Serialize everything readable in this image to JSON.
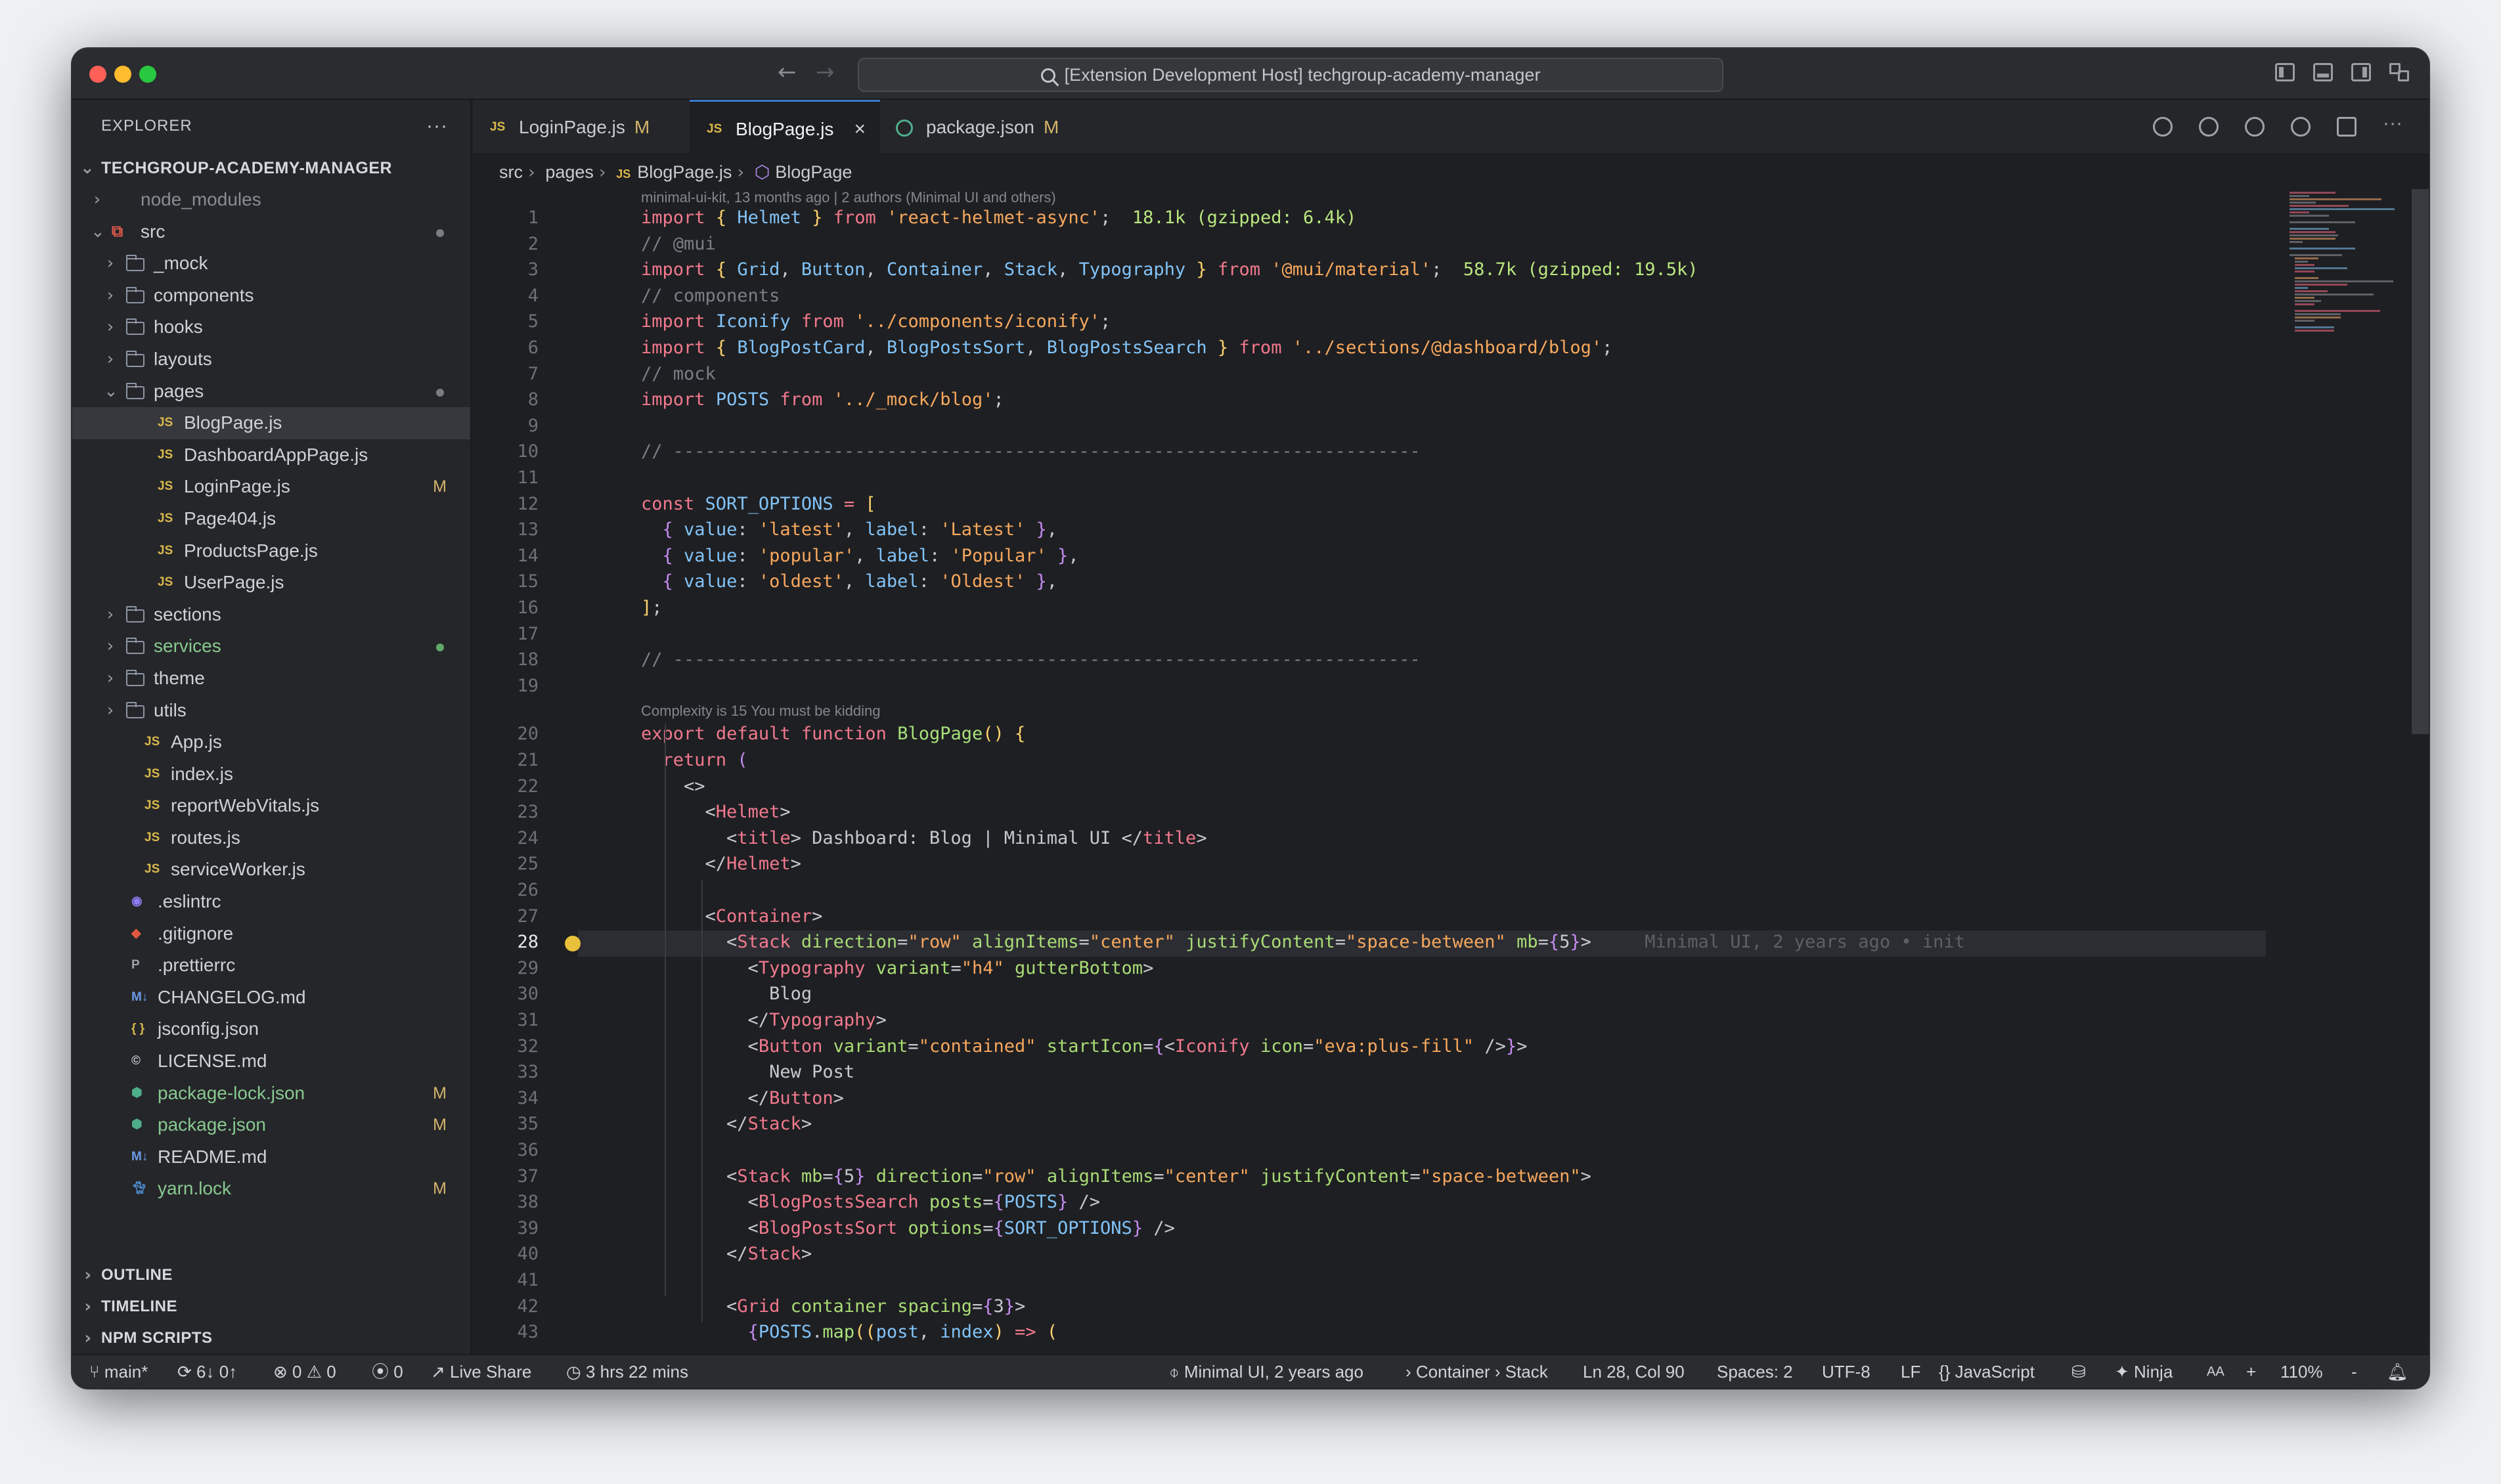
{
  "window": {
    "title": "[Extension Development Host] techgroup-academy-manager"
  },
  "sidebar": {
    "title": "EXPLORER",
    "more": "···",
    "project": "TECHGROUP-ACADEMY-MANAGER",
    "tree": [
      {
        "label": "node_modules",
        "kind": "folder",
        "depth": 0,
        "open": false,
        "dim": true
      },
      {
        "label": "src",
        "kind": "folder-src",
        "depth": 0,
        "open": true,
        "dot": "grey"
      },
      {
        "label": "_mock",
        "kind": "folder",
        "depth": 1,
        "open": false
      },
      {
        "label": "components",
        "kind": "folder",
        "depth": 1,
        "open": false
      },
      {
        "label": "hooks",
        "kind": "folder",
        "depth": 1,
        "open": false
      },
      {
        "label": "layouts",
        "kind": "folder",
        "depth": 1,
        "open": false
      },
      {
        "label": "pages",
        "kind": "folder",
        "depth": 1,
        "open": true,
        "dot": "grey"
      },
      {
        "label": "BlogPage.js",
        "kind": "js",
        "depth": 2,
        "selected": true
      },
      {
        "label": "DashboardAppPage.js",
        "kind": "js",
        "depth": 2
      },
      {
        "label": "LoginPage.js",
        "kind": "js",
        "depth": 2,
        "status": "M"
      },
      {
        "label": "Page404.js",
        "kind": "js",
        "depth": 2
      },
      {
        "label": "ProductsPage.js",
        "kind": "js",
        "depth": 2
      },
      {
        "label": "UserPage.js",
        "kind": "js",
        "depth": 2
      },
      {
        "label": "sections",
        "kind": "folder",
        "depth": 1,
        "open": false
      },
      {
        "label": "services",
        "kind": "folder",
        "depth": 1,
        "open": false,
        "green": true,
        "dot": "green"
      },
      {
        "label": "theme",
        "kind": "folder",
        "depth": 1,
        "open": false
      },
      {
        "label": "utils",
        "kind": "folder",
        "depth": 1,
        "open": false
      },
      {
        "label": "App.js",
        "kind": "js",
        "depth": 1
      },
      {
        "label": "index.js",
        "kind": "js",
        "depth": 1
      },
      {
        "label": "reportWebVitals.js",
        "kind": "js",
        "depth": 1
      },
      {
        "label": "routes.js",
        "kind": "js",
        "depth": 1
      },
      {
        "label": "serviceWorker.js",
        "kind": "js",
        "depth": 1
      },
      {
        "label": ".eslintrc",
        "kind": "eslint",
        "depth": 0
      },
      {
        "label": ".gitignore",
        "kind": "git",
        "depth": 0
      },
      {
        "label": ".prettierrc",
        "kind": "prettier",
        "depth": 0
      },
      {
        "label": "CHANGELOG.md",
        "kind": "md",
        "depth": 0
      },
      {
        "label": "jsconfig.json",
        "kind": "json",
        "depth": 0
      },
      {
        "label": "LICENSE.md",
        "kind": "license",
        "depth": 0
      },
      {
        "label": "package-lock.json",
        "kind": "npm",
        "depth": 0,
        "status": "M",
        "green": true
      },
      {
        "label": "package.json",
        "kind": "npm",
        "depth": 0,
        "status": "M",
        "green": true
      },
      {
        "label": "README.md",
        "kind": "md",
        "depth": 0
      },
      {
        "label": "yarn.lock",
        "kind": "yarn",
        "depth": 0,
        "status": "M",
        "green": true
      }
    ],
    "sections": [
      "OUTLINE",
      "TIMELINE",
      "NPM SCRIPTS"
    ]
  },
  "tabs": [
    {
      "label": "LoginPage.js",
      "badge": "M",
      "icon": "js"
    },
    {
      "label": "BlogPage.js",
      "badge": "",
      "icon": "js",
      "active": true,
      "close": "×"
    },
    {
      "label": "package.json",
      "badge": "M",
      "icon": "npm"
    }
  ],
  "breadcrumb": {
    "items": [
      "src",
      "pages",
      "BlogPage.js",
      "BlogPage"
    ],
    "js_badge": "JS"
  },
  "editor": {
    "blame_header": "minimal-ui-kit, 13 months ago | 2 authors (Minimal UI and others)",
    "complexity_hint": "Complexity is 15 You must be kidding",
    "inline_blame": "Minimal UI, 2 years ago • init",
    "current_line": 28,
    "lines": [
      {
        "n": "1",
        "html": "<span class='kw'>import</span> <span class='cl'>{</span> <span class='id'>Helmet</span> <span class='cl'>}</span> <span class='kw'>from</span> <span class='st'>'react-helmet-async'</span>;  <span class='sz'>18.1k (gzipped: 6.4k)</span>"
      },
      {
        "n": "2",
        "html": "<span class='cm'>// @mui</span>"
      },
      {
        "n": "3",
        "html": "<span class='kw'>import</span> <span class='cl'>{</span> <span class='id'>Grid</span>, <span class='id'>Button</span>, <span class='id'>Container</span>, <span class='id'>Stack</span>, <span class='id'>Typography</span> <span class='cl'>}</span> <span class='kw'>from</span> <span class='st'>'@mui/material'</span>;  <span class='sz'>58.7k (gzipped: 19.5k)</span>"
      },
      {
        "n": "4",
        "html": "<span class='cm'>// components</span>"
      },
      {
        "n": "5",
        "html": "<span class='kw'>import</span> <span class='id'>Iconify</span> <span class='kw'>from</span> <span class='st'>'../components/iconify'</span>;"
      },
      {
        "n": "6",
        "html": "<span class='kw'>import</span> <span class='cl'>{</span> <span class='id'>BlogPostCard</span>, <span class='id'>BlogPostsSort</span>, <span class='id'>BlogPostsSearch</span> <span class='cl'>}</span> <span class='kw'>from</span> <span class='st'>'../sections/@dashboard/blog'</span>;"
      },
      {
        "n": "7",
        "html": "<span class='cm'>// mock</span>"
      },
      {
        "n": "8",
        "html": "<span class='kw'>import</span> <span class='id'>POSTS</span> <span class='kw'>from</span> <span class='st'>'../_mock/blog'</span>;"
      },
      {
        "n": "9",
        "html": ""
      },
      {
        "n": "10",
        "html": "<span class='cm'>// ----------------------------------------------------------------------</span>"
      },
      {
        "n": "11",
        "html": ""
      },
      {
        "n": "12",
        "html": "<span class='kw'>const</span> <span class='id'>SORT_OPTIONS</span> <span class='kw'>=</span> <span class='cl'>[</span>"
      },
      {
        "n": "13",
        "html": "  <span class='br'>{</span> <span class='id'>value</span>: <span class='st'>'latest'</span>, <span class='id'>label</span>: <span class='st'>'Latest'</span> <span class='br'>}</span>,"
      },
      {
        "n": "14",
        "html": "  <span class='br'>{</span> <span class='id'>value</span>: <span class='st'>'popular'</span>, <span class='id'>label</span>: <span class='st'>'Popular'</span> <span class='br'>}</span>,"
      },
      {
        "n": "15",
        "html": "  <span class='br'>{</span> <span class='id'>value</span>: <span class='st'>'oldest'</span>, <span class='id'>label</span>: <span class='st'>'Oldest'</span> <span class='br'>}</span>,"
      },
      {
        "n": "16",
        "html": "<span class='cl'>]</span>;"
      },
      {
        "n": "17",
        "html": ""
      },
      {
        "n": "18",
        "html": "<span class='cm'>// ----------------------------------------------------------------------</span>"
      },
      {
        "n": "19",
        "html": ""
      },
      {
        "n": "20",
        "html": "<span class='kw'>export</span> <span class='kw'>default</span> <span class='kw'>function</span> <span class='fn'>BlogPage</span><span class='cl'>()</span> <span class='cl'>{</span>"
      },
      {
        "n": "21",
        "html": "  <span class='kw'>return</span> <span class='br'>(</span>"
      },
      {
        "n": "22",
        "html": "    &lt;&gt;"
      },
      {
        "n": "23",
        "html": "      &lt;<span class='tg'>Helmet</span>&gt;"
      },
      {
        "n": "24",
        "html": "        &lt;<span class='tg'>title</span>&gt; Dashboard: Blog | Minimal UI &lt;/<span class='tg'>title</span>&gt;"
      },
      {
        "n": "25",
        "html": "      &lt;/<span class='tg'>Helmet</span>&gt;"
      },
      {
        "n": "26",
        "html": ""
      },
      {
        "n": "27",
        "html": "      &lt;<span class='tg'>Container</span>&gt;"
      },
      {
        "n": "28",
        "html": "        &lt;<span class='tg'>Stack</span> <span class='at'>direction</span>=<span class='vl'>\"row\"</span> <span class='at'>alignItems</span>=<span class='vl'>\"center\"</span> <span class='at'>justifyContent</span>=<span class='vl'>\"space-between\"</span> <span class='at'>mb</span>=<span class='br'>{</span>5<span class='br'>}</span>&gt;     <span class='inlinehint'>Minimal UI, 2 years ago • init</span>"
      },
      {
        "n": "29",
        "html": "          &lt;<span class='tg'>Typography</span> <span class='at'>variant</span>=<span class='vl'>\"h4\"</span> <span class='at'>gutterBottom</span>&gt;"
      },
      {
        "n": "30",
        "html": "            Blog"
      },
      {
        "n": "31",
        "html": "          &lt;/<span class='tg'>Typography</span>&gt;"
      },
      {
        "n": "32",
        "html": "          &lt;<span class='tg'>Button</span> <span class='at'>variant</span>=<span class='vl'>\"contained\"</span> <span class='at'>startIcon</span>=<span class='br'>{</span>&lt;<span class='tg'>Iconify</span> <span class='at'>icon</span>=<span class='vl'>\"eva:plus-fill\"</span> /&gt;<span class='br'>}</span>&gt;"
      },
      {
        "n": "33",
        "html": "            New Post"
      },
      {
        "n": "34",
        "html": "          &lt;/<span class='tg'>Button</span>&gt;"
      },
      {
        "n": "35",
        "html": "        &lt;/<span class='tg'>Stack</span>&gt;"
      },
      {
        "n": "36",
        "html": ""
      },
      {
        "n": "37",
        "html": "        &lt;<span class='tg'>Stack</span> <span class='at'>mb</span>=<span class='br'>{</span>5<span class='br'>}</span> <span class='at'>direction</span>=<span class='vl'>\"row\"</span> <span class='at'>alignItems</span>=<span class='vl'>\"center\"</span> <span class='at'>justifyContent</span>=<span class='vl'>\"space-between\"</span>&gt;"
      },
      {
        "n": "38",
        "html": "          &lt;<span class='tg'>BlogPostsSearch</span> <span class='at'>posts</span>=<span class='br'>{</span><span class='id'>POSTS</span><span class='br'>}</span> /&gt;"
      },
      {
        "n": "39",
        "html": "          &lt;<span class='tg'>BlogPostsSort</span> <span class='at'>options</span>=<span class='br'>{</span><span class='id'>SORT_OPTIONS</span><span class='br'>}</span> /&gt;"
      },
      {
        "n": "40",
        "html": "        &lt;/<span class='tg'>Stack</span>&gt;"
      },
      {
        "n": "41",
        "html": ""
      },
      {
        "n": "42",
        "html": "        &lt;<span class='tg'>Grid</span> <span class='at'>container</span> <span class='at'>spacing</span>=<span class='br'>{</span>3<span class='br'>}</span>&gt;"
      },
      {
        "n": "43",
        "html": "          <span class='br'>{</span><span class='id'>POSTS</span>.<span class='fn'>map</span><span class='cl'>((</span><span class='id'>post</span>, <span class='id'>index</span><span class='cl'>)</span> <span class='kw'>=&gt;</span> <span class='cl'>(</span>"
      }
    ]
  },
  "statusbar": {
    "branch": "main*",
    "sync": "6↓ 0↑",
    "errors": "0",
    "warnings": "0",
    "ports": "0",
    "liveshare": "Live Share",
    "timer": "3 hrs 22 mins",
    "blame": "Minimal UI, 2 years ago",
    "breadcrumb": "› Container › Stack",
    "position": "Ln 28, Col 90",
    "spaces": "Spaces: 2",
    "encoding": "UTF-8",
    "eol": "LF",
    "language": "JavaScript",
    "ninja": "Ninja",
    "aa": "AA",
    "plus": "+",
    "zoom": "110%",
    "minus": "-"
  },
  "colors": {
    "accent": "#3a78c9",
    "modified": "#d4b46a",
    "added": "#5fa86a"
  }
}
